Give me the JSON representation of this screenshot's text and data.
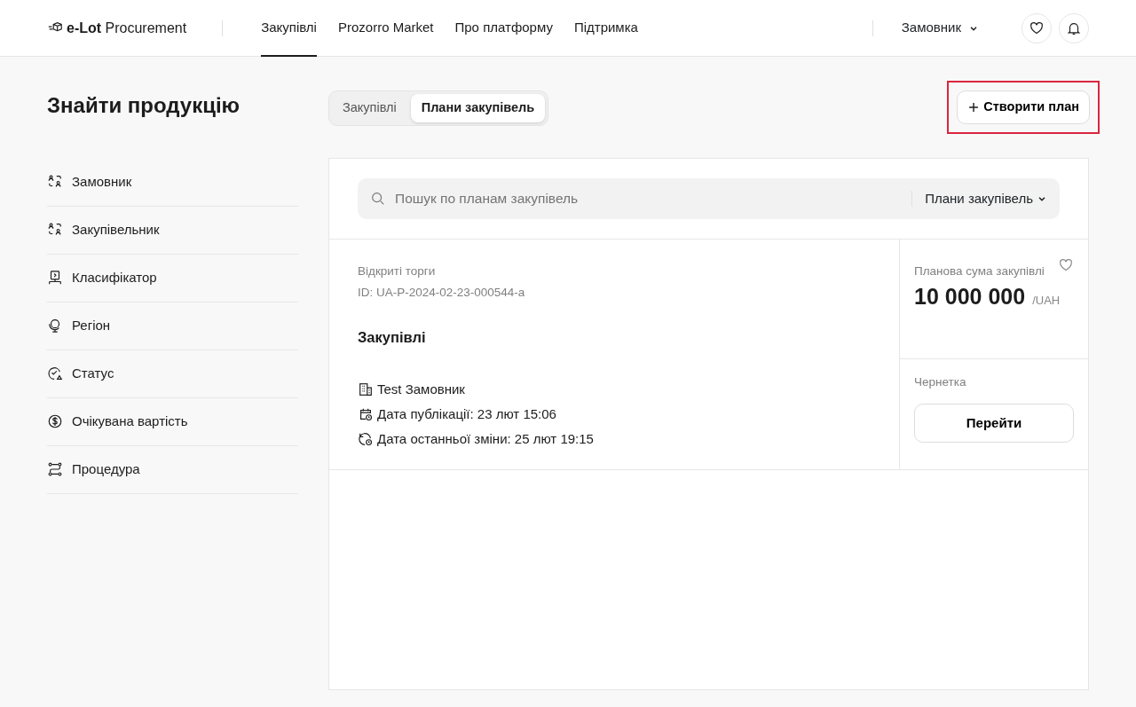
{
  "header": {
    "logo": {
      "bold": "e-Lot",
      "text": "Procurement"
    },
    "nav": [
      {
        "label": "Закупівлі",
        "selected": true
      },
      {
        "label": "Prozorro Market",
        "selected": false
      },
      {
        "label": "Про платформу",
        "selected": false
      },
      {
        "label": "Підтримка",
        "selected": false
      }
    ],
    "role_menu": "Замовник"
  },
  "sidebar": {
    "title": "Знайти продукцію",
    "filters": [
      {
        "label": "Замовник"
      },
      {
        "label": "Закупівельник"
      },
      {
        "label": "Класифікатор"
      },
      {
        "label": "Регіон"
      },
      {
        "label": "Статус"
      },
      {
        "label": "Очікувана вартість"
      },
      {
        "label": "Процедура"
      }
    ]
  },
  "tabs": [
    {
      "label": "Закупівлі",
      "selected": false
    },
    {
      "label": "Плани закупівель",
      "selected": true
    }
  ],
  "create_button": {
    "label": "Створити план",
    "highlighted": true
  },
  "search": {
    "placeholder": "Пошук по планам закупівель",
    "scope": "Плани закупівель"
  },
  "plans": [
    {
      "procedure": "Відкриті торги",
      "id": "ID: UA-P-2024-02-23-000544-a",
      "title": "Закупівлі",
      "buyer": "Test Замовник",
      "published": "Дата публікації: 23 лют 15:06",
      "modified": "Дата останньої зміни: 25 лют 19:15",
      "amount_label": "Планова сума закупівлі",
      "amount": "10 000 000",
      "currency": "/UAH",
      "status": "Чернетка",
      "action": "Перейти"
    }
  ]
}
